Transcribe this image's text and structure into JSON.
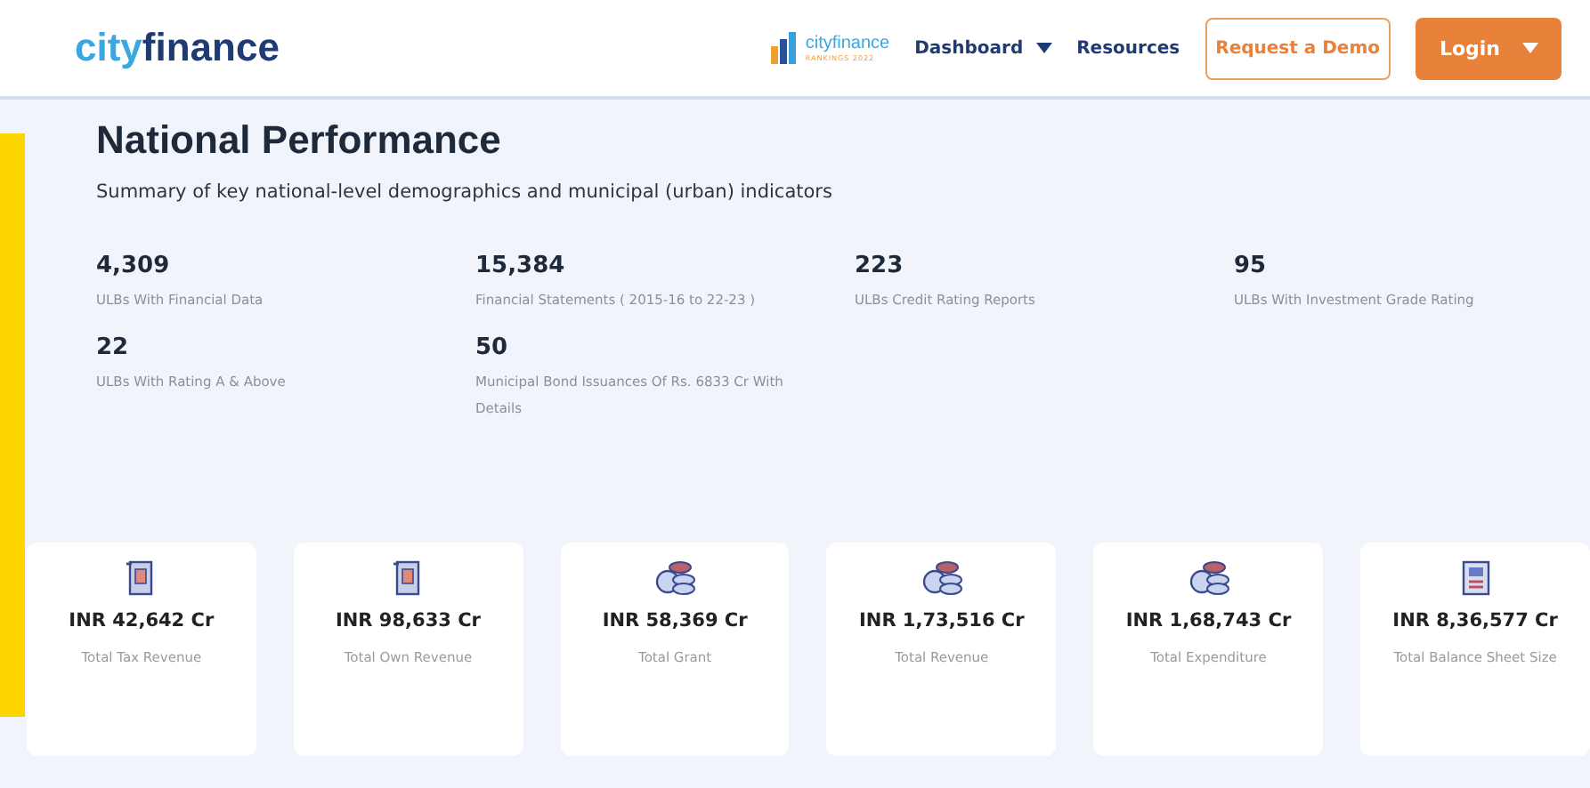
{
  "header": {
    "logo": {
      "prefix": "city",
      "suffix": "finance"
    },
    "rankings_logo": {
      "name": "cityfinance",
      "tagline": "RANKINGS 2022"
    },
    "nav": [
      {
        "label": "Dashboard",
        "dropdown": true
      },
      {
        "label": "Resources",
        "dropdown": false
      }
    ],
    "demo_button": "Request a Demo",
    "login_button": {
      "label": "Login",
      "dropdown": true
    }
  },
  "section": {
    "title": "National Performance",
    "subtitle": "Summary of key national-level demographics and municipal (urban) indicators"
  },
  "stats": [
    {
      "value": "4,309",
      "label": "ULBs With Financial Data"
    },
    {
      "value": "15,384",
      "label": "Financial Statements ( 2015-16 to 22-23 )"
    },
    {
      "value": "223",
      "label": "ULBs Credit Rating Reports"
    },
    {
      "value": "95",
      "label": "ULBs With Investment Grade Rating"
    },
    {
      "value": "22",
      "label": "ULBs With Rating A & Above"
    },
    {
      "value": "50",
      "label": "Municipal Bond Issuances Of Rs. 6833 Cr With Details"
    }
  ],
  "cards": [
    {
      "kind": "receipt",
      "amount": "INR 42,642 Cr",
      "label": "Total Tax Revenue"
    },
    {
      "kind": "receipt",
      "amount": "INR 98,633 Cr",
      "label": "Total Own Revenue"
    },
    {
      "kind": "coins",
      "amount": "INR 58,369 Cr",
      "label": "Total Grant"
    },
    {
      "kind": "coins",
      "amount": "INR 1,73,516 Cr",
      "label": "Total Revenue"
    },
    {
      "kind": "coins",
      "amount": "INR 1,68,743 Cr",
      "label": "Total Expenditure"
    },
    {
      "kind": "sheet",
      "amount": "INR 8,36,577 Cr",
      "label": "Total Balance Sheet Size"
    }
  ]
}
